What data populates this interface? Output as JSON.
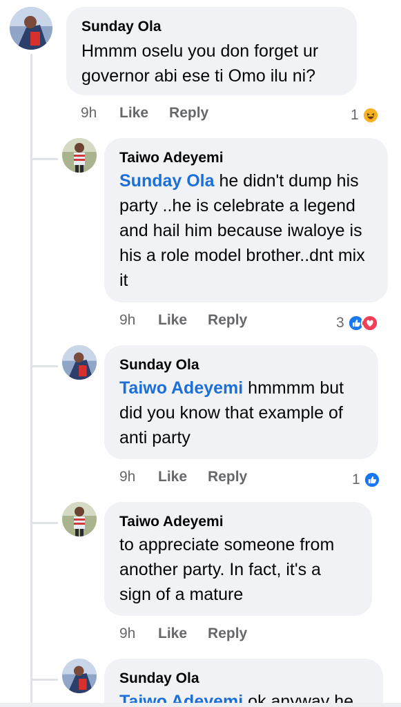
{
  "comments": [
    {
      "author": "Sunday Ola",
      "mention": "",
      "text": "Hmmm oselu you don forget ur governor abi ese ti Omo ilu ni?",
      "time": "9h",
      "like_label": "Like",
      "reply_label": "Reply",
      "reaction_count": "1",
      "reactions": [
        "haha-icon"
      ]
    },
    {
      "author": "Taiwo Adeyemi",
      "mention": "Sunday Ola",
      "text": " he didn't dump his party ..he is celebrate a legend and hail him because iwaloye is his a role model brother..dnt mix it",
      "time": "9h",
      "like_label": "Like",
      "reply_label": "Reply",
      "reaction_count": "3",
      "reactions": [
        "like-icon",
        "love-icon"
      ]
    },
    {
      "author": "Sunday Ola",
      "mention": "Taiwo Adeyemi",
      "text": " hmmmm but did you know that example of anti party",
      "time": "9h",
      "like_label": "Like",
      "reply_label": "Reply",
      "reaction_count": "1",
      "reactions": [
        "like-icon"
      ]
    },
    {
      "author": "Taiwo Adeyemi",
      "mention": "",
      "text": "to appreciate someone from another party. In fact, it's a sign of a mature",
      "time": "9h",
      "like_label": "Like",
      "reply_label": "Reply",
      "reaction_count": "",
      "reactions": []
    },
    {
      "author": "Sunday Ola",
      "mention": "Taiwo Adeyemi",
      "text": " ok anyway he",
      "time": "",
      "like_label": "",
      "reply_label": "",
      "reaction_count": "",
      "reactions": []
    }
  ],
  "colors": {
    "bubble": "#f0f2f5",
    "mention": "#1c6fd8",
    "meta": "#65676b",
    "like": "#1877f2",
    "love": "#f33e58",
    "haha": "#f7b125"
  }
}
